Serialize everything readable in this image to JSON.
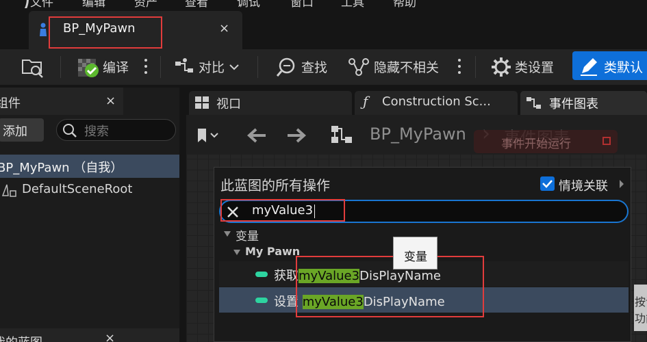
{
  "menubar": {
    "items": [
      "文件",
      "编辑",
      "资产",
      "查看",
      "调试",
      "窗口",
      "工具",
      "帮助"
    ]
  },
  "tab": {
    "title": "BP_MyPawn",
    "close": "×"
  },
  "toolbar": {
    "compile": "编译",
    "diff": "对比",
    "find": "查找",
    "hide_unrelated": "隐藏不相关",
    "class_settings": "类设置",
    "class_defaults": "类默认"
  },
  "left_panel": {
    "title": "组件",
    "close": "×",
    "add": "添加",
    "search_placeholder": "搜索",
    "items": [
      {
        "label": "BP_MyPawn （自我）"
      },
      {
        "label": "DefaultSceneRoot"
      }
    ],
    "bottom_label": "我的蓝图"
  },
  "editor_tabs": {
    "viewport": "视口",
    "construction": "Construction Sc...",
    "event_graph": "事件图表",
    "close": "×"
  },
  "graph_nav": {
    "breadcrumb_root": "BP_MyPawn",
    "breadcrumb_sep": "›",
    "breadcrumb_leaf": "事件图表",
    "overlay_node": "事件开始运行"
  },
  "action_menu": {
    "title": "此蓝图的所有操作",
    "context_label": "情境关联",
    "context_checked": true,
    "search_value": "myValue3",
    "category": "变量",
    "subcategory": "My Pawn",
    "items": [
      {
        "prefix": "获取",
        "match": "myValue3",
        "suffix": "DisPlayName"
      },
      {
        "prefix": "设置 ",
        "match": "myValue3",
        "suffix": "DisPlayName"
      }
    ],
    "tooltip": "变量"
  },
  "right_fragment": {
    "line1": "按调",
    "line2": "功能"
  },
  "colors": {
    "accent": "#0e6fd9",
    "highlight": "#6aa626",
    "variable_pill": "#2ed4a0",
    "selection": "#3b4a5e",
    "annotation": "#e23c3c"
  }
}
